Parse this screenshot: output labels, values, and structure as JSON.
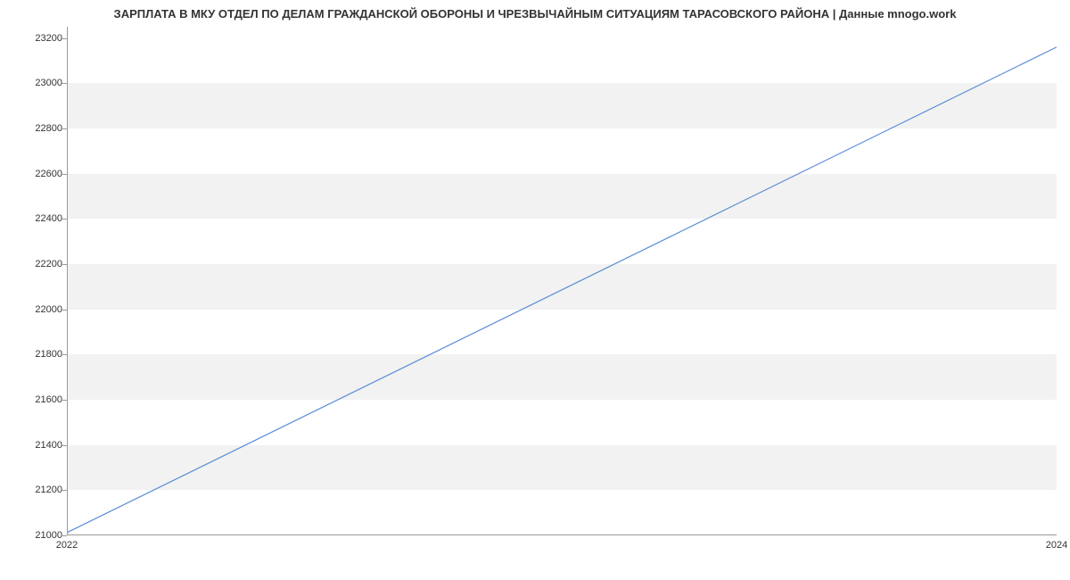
{
  "chart_data": {
    "type": "line",
    "title": "ЗАРПЛАТА В МКУ ОТДЕЛ ПО ДЕЛАМ ГРАЖДАНСКОЙ ОБОРОНЫ И ЧРЕЗВЫЧАЙНЫМ СИТУАЦИЯМ ТАРАСОВСКОГО РАЙОНА | Данные mnogo.work",
    "xlabel": "",
    "ylabel": "",
    "x": [
      2022,
      2024
    ],
    "values": [
      21010,
      23160
    ],
    "xlim": [
      2022,
      2024
    ],
    "ylim": [
      21000,
      23250
    ],
    "y_ticks": [
      21000,
      21200,
      21400,
      21600,
      21800,
      22000,
      22200,
      22400,
      22600,
      22800,
      23000,
      23200
    ],
    "x_ticks": [
      2022,
      2024
    ],
    "line_color": "#5b8dd6",
    "band_color": "#f2f2f2"
  }
}
